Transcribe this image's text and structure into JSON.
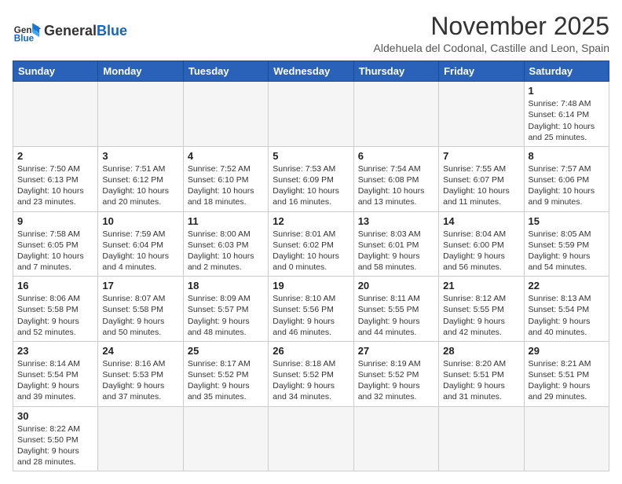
{
  "logo": {
    "text_general": "General",
    "text_blue": "Blue"
  },
  "title": {
    "month": "November 2025",
    "location": "Aldehuela del Codonal, Castille and Leon, Spain"
  },
  "weekdays": [
    "Sunday",
    "Monday",
    "Tuesday",
    "Wednesday",
    "Thursday",
    "Friday",
    "Saturday"
  ],
  "weeks": [
    [
      {
        "day": "",
        "info": ""
      },
      {
        "day": "",
        "info": ""
      },
      {
        "day": "",
        "info": ""
      },
      {
        "day": "",
        "info": ""
      },
      {
        "day": "",
        "info": ""
      },
      {
        "day": "",
        "info": ""
      },
      {
        "day": "1",
        "info": "Sunrise: 7:48 AM\nSunset: 6:14 PM\nDaylight: 10 hours and 25 minutes."
      }
    ],
    [
      {
        "day": "2",
        "info": "Sunrise: 7:50 AM\nSunset: 6:13 PM\nDaylight: 10 hours and 23 minutes."
      },
      {
        "day": "3",
        "info": "Sunrise: 7:51 AM\nSunset: 6:12 PM\nDaylight: 10 hours and 20 minutes."
      },
      {
        "day": "4",
        "info": "Sunrise: 7:52 AM\nSunset: 6:10 PM\nDaylight: 10 hours and 18 minutes."
      },
      {
        "day": "5",
        "info": "Sunrise: 7:53 AM\nSunset: 6:09 PM\nDaylight: 10 hours and 16 minutes."
      },
      {
        "day": "6",
        "info": "Sunrise: 7:54 AM\nSunset: 6:08 PM\nDaylight: 10 hours and 13 minutes."
      },
      {
        "day": "7",
        "info": "Sunrise: 7:55 AM\nSunset: 6:07 PM\nDaylight: 10 hours and 11 minutes."
      },
      {
        "day": "8",
        "info": "Sunrise: 7:57 AM\nSunset: 6:06 PM\nDaylight: 10 hours and 9 minutes."
      }
    ],
    [
      {
        "day": "9",
        "info": "Sunrise: 7:58 AM\nSunset: 6:05 PM\nDaylight: 10 hours and 7 minutes."
      },
      {
        "day": "10",
        "info": "Sunrise: 7:59 AM\nSunset: 6:04 PM\nDaylight: 10 hours and 4 minutes."
      },
      {
        "day": "11",
        "info": "Sunrise: 8:00 AM\nSunset: 6:03 PM\nDaylight: 10 hours and 2 minutes."
      },
      {
        "day": "12",
        "info": "Sunrise: 8:01 AM\nSunset: 6:02 PM\nDaylight: 10 hours and 0 minutes."
      },
      {
        "day": "13",
        "info": "Sunrise: 8:03 AM\nSunset: 6:01 PM\nDaylight: 9 hours and 58 minutes."
      },
      {
        "day": "14",
        "info": "Sunrise: 8:04 AM\nSunset: 6:00 PM\nDaylight: 9 hours and 56 minutes."
      },
      {
        "day": "15",
        "info": "Sunrise: 8:05 AM\nSunset: 5:59 PM\nDaylight: 9 hours and 54 minutes."
      }
    ],
    [
      {
        "day": "16",
        "info": "Sunrise: 8:06 AM\nSunset: 5:58 PM\nDaylight: 9 hours and 52 minutes."
      },
      {
        "day": "17",
        "info": "Sunrise: 8:07 AM\nSunset: 5:58 PM\nDaylight: 9 hours and 50 minutes."
      },
      {
        "day": "18",
        "info": "Sunrise: 8:09 AM\nSunset: 5:57 PM\nDaylight: 9 hours and 48 minutes."
      },
      {
        "day": "19",
        "info": "Sunrise: 8:10 AM\nSunset: 5:56 PM\nDaylight: 9 hours and 46 minutes."
      },
      {
        "day": "20",
        "info": "Sunrise: 8:11 AM\nSunset: 5:55 PM\nDaylight: 9 hours and 44 minutes."
      },
      {
        "day": "21",
        "info": "Sunrise: 8:12 AM\nSunset: 5:55 PM\nDaylight: 9 hours and 42 minutes."
      },
      {
        "day": "22",
        "info": "Sunrise: 8:13 AM\nSunset: 5:54 PM\nDaylight: 9 hours and 40 minutes."
      }
    ],
    [
      {
        "day": "23",
        "info": "Sunrise: 8:14 AM\nSunset: 5:54 PM\nDaylight: 9 hours and 39 minutes."
      },
      {
        "day": "24",
        "info": "Sunrise: 8:16 AM\nSunset: 5:53 PM\nDaylight: 9 hours and 37 minutes."
      },
      {
        "day": "25",
        "info": "Sunrise: 8:17 AM\nSunset: 5:52 PM\nDaylight: 9 hours and 35 minutes."
      },
      {
        "day": "26",
        "info": "Sunrise: 8:18 AM\nSunset: 5:52 PM\nDaylight: 9 hours and 34 minutes."
      },
      {
        "day": "27",
        "info": "Sunrise: 8:19 AM\nSunset: 5:52 PM\nDaylight: 9 hours and 32 minutes."
      },
      {
        "day": "28",
        "info": "Sunrise: 8:20 AM\nSunset: 5:51 PM\nDaylight: 9 hours and 31 minutes."
      },
      {
        "day": "29",
        "info": "Sunrise: 8:21 AM\nSunset: 5:51 PM\nDaylight: 9 hours and 29 minutes."
      }
    ],
    [
      {
        "day": "30",
        "info": "Sunrise: 8:22 AM\nSunset: 5:50 PM\nDaylight: 9 hours and 28 minutes."
      },
      {
        "day": "",
        "info": ""
      },
      {
        "day": "",
        "info": ""
      },
      {
        "day": "",
        "info": ""
      },
      {
        "day": "",
        "info": ""
      },
      {
        "day": "",
        "info": ""
      },
      {
        "day": "",
        "info": ""
      }
    ]
  ]
}
